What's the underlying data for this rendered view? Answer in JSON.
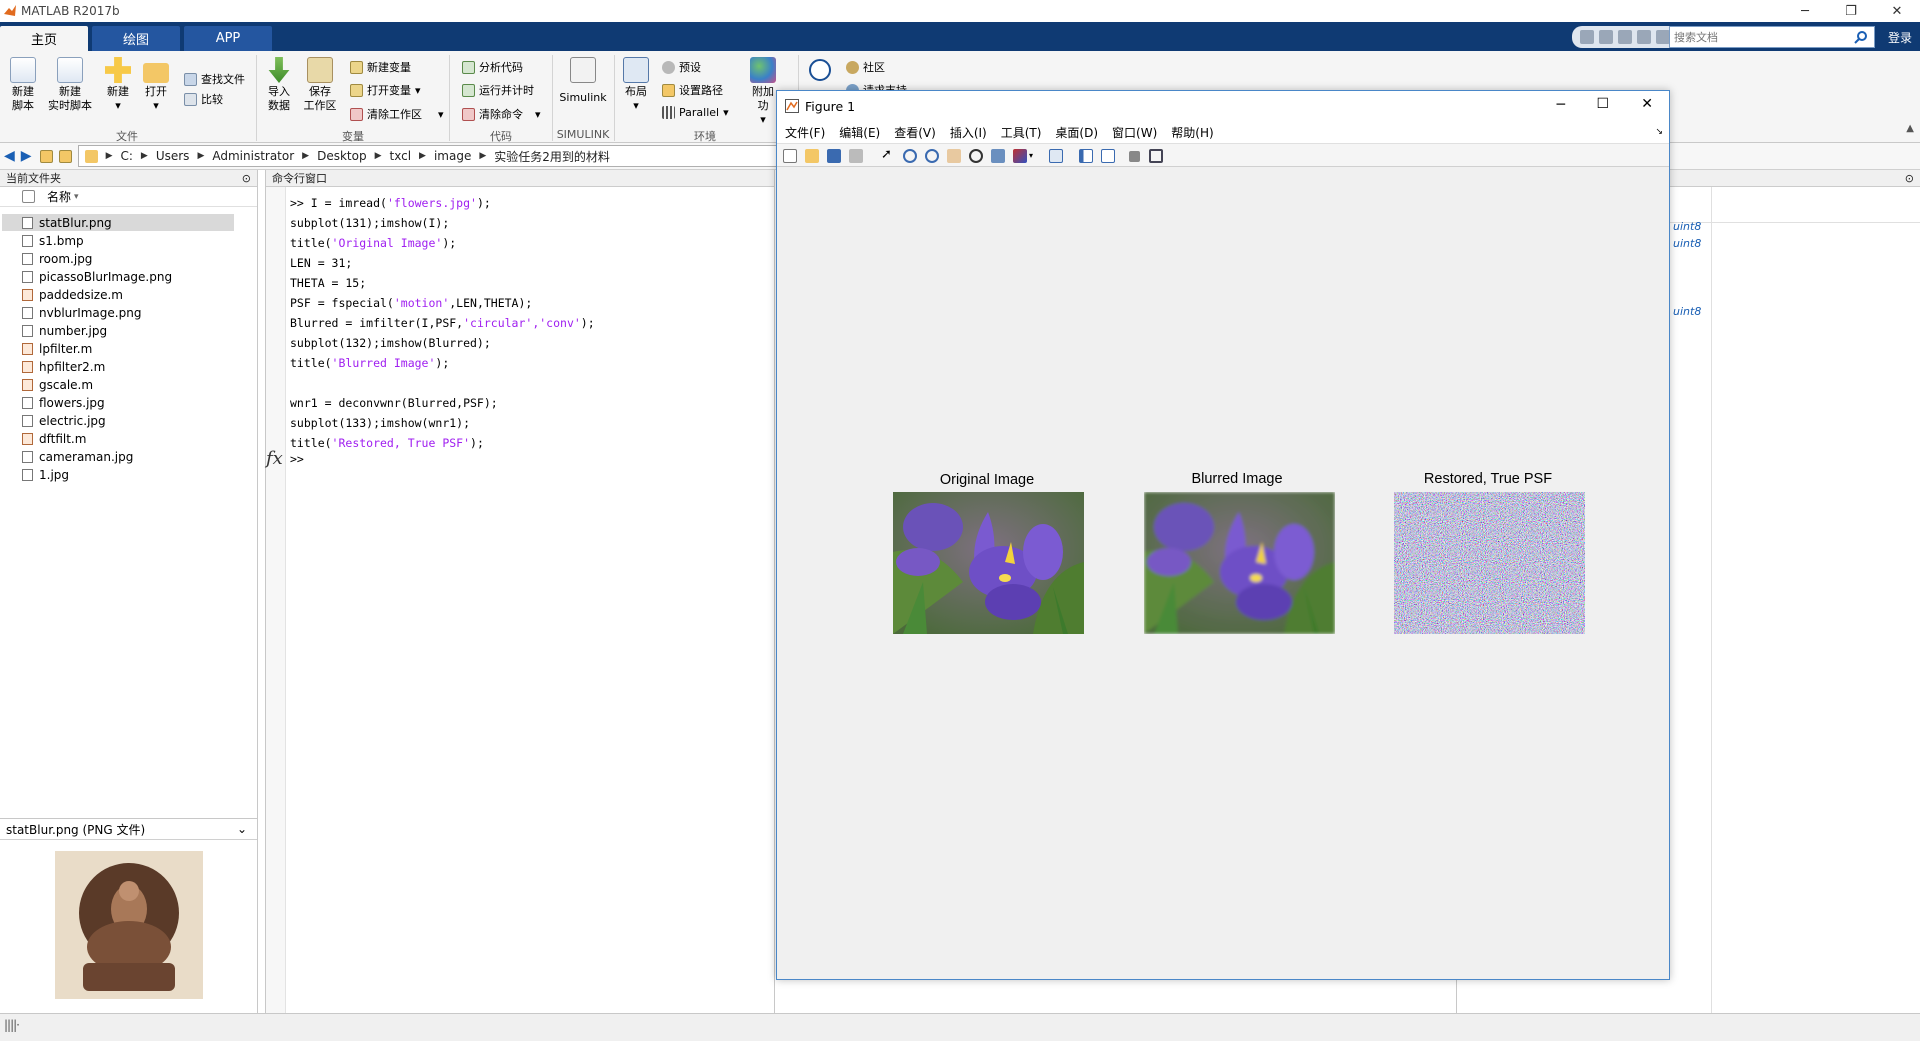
{
  "app_title": "MATLAB R2017b",
  "tabs": [
    "主页",
    "绘图",
    "APP"
  ],
  "search_docs_placeholder": "搜索文档",
  "login_label": "登录",
  "ribbon": {
    "file": {
      "new_script": "新建\n脚本",
      "new_live": "新建\n实时脚本",
      "new": "新建",
      "open": "打开",
      "find_files": "查找文件",
      "compare": "比较",
      "group": "文件"
    },
    "variable": {
      "import": "导入\n数据",
      "save_ws": "保存\n工作区",
      "new_var": "新建变量",
      "open_var": "打开变量",
      "clear_ws": "清除工作区",
      "group": "变量"
    },
    "code": {
      "analyze": "分析代码",
      "run_time": "运行并计时",
      "clear_cmd": "清除命令",
      "group": "代码"
    },
    "simulink": {
      "label": "Simulink",
      "group": "SIMULINK"
    },
    "env": {
      "layout": "布局",
      "prefs": "预设",
      "set_path": "设置路径",
      "parallel": "Parallel",
      "addons": "附加功",
      "group": "环境"
    },
    "resources": {
      "community": "社区",
      "request": "请求支持"
    }
  },
  "address": [
    "C:",
    "Users",
    "Administrator",
    "Desktop",
    "txcl",
    "image",
    "实验任务2用到的材料"
  ],
  "current_folder": {
    "header": "当前文件夹",
    "name_col": "名称",
    "files": [
      {
        "name": "statBlur.png",
        "type": "img"
      },
      {
        "name": "s1.bmp",
        "type": "img"
      },
      {
        "name": "room.jpg",
        "type": "img"
      },
      {
        "name": "picassoBlurImage.png",
        "type": "img"
      },
      {
        "name": "paddedsize.m",
        "type": "m"
      },
      {
        "name": "nvblurImage.png",
        "type": "img"
      },
      {
        "name": "number.jpg",
        "type": "img"
      },
      {
        "name": "lpfilter.m",
        "type": "m"
      },
      {
        "name": "hpfilter2.m",
        "type": "m"
      },
      {
        "name": "gscale.m",
        "type": "m"
      },
      {
        "name": "flowers.jpg",
        "type": "img"
      },
      {
        "name": "electric.jpg",
        "type": "img"
      },
      {
        "name": "dftfilt.m",
        "type": "m"
      },
      {
        "name": "cameraman.jpg",
        "type": "img"
      },
      {
        "name": "1.jpg",
        "type": "img"
      }
    ],
    "selected": "statBlur.png",
    "preview_label": "statBlur.png  (PNG 文件)"
  },
  "command_window": {
    "header": "命令行窗口",
    "lines": [
      [
        ">> I = imread(",
        "'flowers.jpg'",
        ");"
      ],
      [
        "subplot(131);imshow(I);",
        "",
        ""
      ],
      [
        "title(",
        "'Original Image'",
        ");"
      ],
      [
        "LEN = 31;",
        "",
        ""
      ],
      [
        "THETA = 15;",
        "",
        ""
      ],
      [
        "PSF = fspecial(",
        "'motion'",
        ",LEN,THETA);"
      ],
      [
        "Blurred = imfilter(I,PSF,",
        "'circular','conv'",
        ");"
      ],
      [
        "subplot(132);imshow(Blurred);",
        "",
        ""
      ],
      [
        "title(",
        "'Blurred Image'",
        ");"
      ],
      [
        "",
        "",
        ""
      ],
      [
        "wnr1 = deconvwnr(Blurred,PSF);",
        "",
        ""
      ],
      [
        "subplot(133);imshow(wnr1);",
        "",
        ""
      ],
      [
        "title(",
        "'Restored, True PSF'",
        ");"
      ]
    ],
    "prompt": ">>",
    "fx": "fx"
  },
  "workspace_types": [
    "uint8",
    "uint8",
    "uint8"
  ],
  "figure": {
    "title": "Figure 1",
    "menu": [
      "文件(F)",
      "编辑(E)",
      "查看(V)",
      "插入(I)",
      "工具(T)",
      "桌面(D)",
      "窗口(W)",
      "帮助(H)"
    ],
    "axes_titles": [
      "Original Image",
      "Blurred Image",
      "Restored, True PSF"
    ]
  }
}
